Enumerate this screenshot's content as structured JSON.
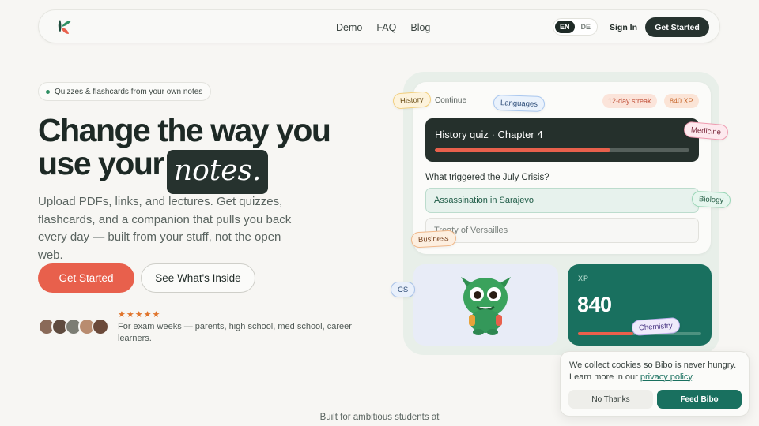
{
  "nav": {
    "links": [
      "Demo",
      "FAQ",
      "Blog"
    ],
    "lang": [
      "EN",
      "DE"
    ],
    "lang_active": "EN",
    "signin": "Sign In",
    "cta": "Get Started"
  },
  "hero": {
    "pill": "Quizzes & flashcards from your own notes",
    "title_line1": "Change the way you",
    "title_line2_prefix": "use your",
    "title_highlight": "notes.",
    "subtitle": "Upload PDFs, links, and lectures. Get quizzes, flashcards, and a companion that pulls you back every day — built from your stuff, not the open web.",
    "primary_cta": "Get Started",
    "secondary_cta": "See What's Inside",
    "rating_stars": 5,
    "stars_text": "★★★★★",
    "social_proof": "For exam weeks — parents, high school, med school, career learners."
  },
  "showcase": {
    "continue_label": "Continue",
    "streak": "12-day streak",
    "xp_badge": "840 XP",
    "quiz_title": "History quiz · Chapter 4",
    "quiz_progress": 0.69,
    "question": "What triggered the July Crisis?",
    "answers": [
      "Assassination in Sarajevo",
      "Treaty of Versailles"
    ],
    "xp_label": "XP",
    "xp_value": "840",
    "xp_progress": 0.45,
    "tags": [
      "History",
      "Languages",
      "Medicine",
      "Biology",
      "Business",
      "CS",
      "Chemistry"
    ]
  },
  "cookie": {
    "text_before": "We collect cookies so Bibo is never hungry. Learn more in our ",
    "link": "privacy policy",
    "text_after": ".",
    "decline": "No Thanks",
    "accept": "Feed Bibo"
  },
  "footer": {
    "line": "Built for ambitious students at"
  },
  "colors": {
    "accent": "#e8604c",
    "brand_dark": "#26322e",
    "brand_green": "#19705f",
    "background": "#f7f6f3"
  }
}
